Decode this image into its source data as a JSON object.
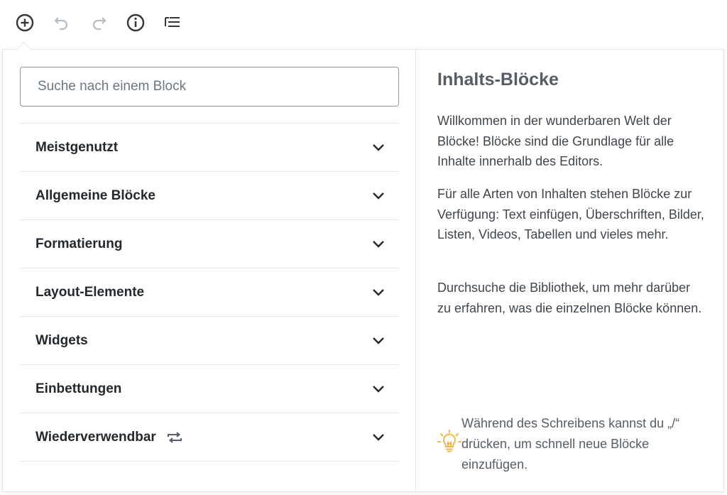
{
  "toolbar": {
    "icons": [
      "add-block-icon",
      "undo-icon",
      "redo-icon",
      "info-icon",
      "block-navigation-icon"
    ]
  },
  "inserter": {
    "search_placeholder": "Suche nach einem Block",
    "categories": [
      {
        "label": "Meistgenutzt"
      },
      {
        "label": "Allgemeine Blöcke"
      },
      {
        "label": "Formatierung"
      },
      {
        "label": "Layout-Elemente"
      },
      {
        "label": "Widgets"
      },
      {
        "label": "Einbettungen"
      },
      {
        "label": "Wiederverwendbar",
        "icon": "reusable-icon"
      }
    ]
  },
  "help": {
    "title": "Inhalts-Blöcke",
    "paragraphs": [
      "Willkommen in der wunderbaren Welt der Blöcke! Blöcke sind die Grundlage für alle Inhalte innerhalb des Editors.",
      "Für alle Arten von Inhalten stehen Blöcke zur Verfügung: Text einfügen, Überschriften, Bilder, Listen, Videos, Tabellen und vieles mehr.",
      "Durchsuche die Bibliothek, um mehr darüber zu erfahren, was die einzelnen Blöcke können."
    ],
    "tip": "Während des Schreibens kannst du „/“ drücken, um schnell neue Blöcke einzufügen."
  },
  "colors": {
    "tip_icon": "#f0b849",
    "border": "#e2e4e7",
    "toolbar_active": "#32373c",
    "toolbar_disabled": "#b5bcc2"
  }
}
